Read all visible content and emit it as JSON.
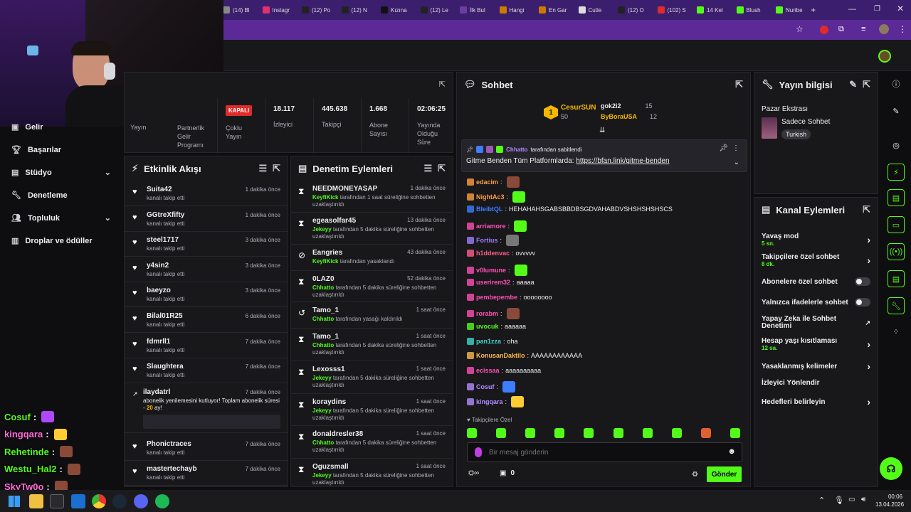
{
  "browser": {
    "tabs": [
      "(14) Bl",
      "Instagr",
      "(12) Po",
      "(12) N",
      "Kızına",
      "(12) Le",
      "İlk Bul",
      "Hangi",
      "En Gar",
      "Cutle",
      "(12) O",
      "(102) S",
      "14 Kel",
      "Blush",
      "Nuribe"
    ],
    "new_tab": "+"
  },
  "stats": {
    "status": "KAPALI",
    "items": [
      {
        "value": "",
        "label": "Yayın"
      },
      {
        "value": "",
        "label": "Partnerlik Gelir Programı"
      },
      {
        "value": "",
        "label": "Çoklu Yayın"
      },
      {
        "value": "18.117",
        "label": "İzleyici"
      },
      {
        "value": "445.638",
        "label": "Takipçi"
      },
      {
        "value": "1.668",
        "label": "Abone Sayısı"
      },
      {
        "value": "02:06:25",
        "label": "Yayında Olduğu Süre"
      }
    ]
  },
  "sidebar": {
    "items": [
      {
        "label": "Gelir"
      },
      {
        "label": "Başarılar"
      },
      {
        "label": "Stüdyo"
      },
      {
        "label": "Denetleme"
      },
      {
        "label": "Topluluk"
      },
      {
        "label": "Droplar ve ödüller"
      }
    ]
  },
  "activity": {
    "title": "Etkinlik Akışı",
    "events": [
      {
        "name": "Suita42",
        "time": "1 dakika önce",
        "desc": "kanalı takip etti"
      },
      {
        "name": "GGtreXfifty",
        "time": "1 dakika önce",
        "desc": "kanalı takip etti"
      },
      {
        "name": "steel1717",
        "time": "3 dakika önce",
        "desc": "kanalı takip etti"
      },
      {
        "name": "y4sin2",
        "time": "3 dakika önce",
        "desc": "kanalı takip etti"
      },
      {
        "name": "baeyzo",
        "time": "3 dakika önce",
        "desc": "kanalı takip etti"
      },
      {
        "name": "Bilal01R25",
        "time": "6 dakika önce",
        "desc": "kanalı takip etti"
      },
      {
        "name": "fdmrll1",
        "time": "7 dakika önce",
        "desc": "kanalı takip etti"
      },
      {
        "name": "Slaughtera",
        "time": "7 dakika önce",
        "desc": "kanalı takip etti"
      }
    ],
    "sub_event": {
      "name": "ilaydatrl",
      "time": "7 dakika önce",
      "desc": "abonelik yenilemesini kutluyor! Toplam abonelik süresi - ",
      "months": "20",
      "unit": "ay!"
    },
    "more_events": [
      {
        "name": "Phonictraces",
        "time": "7 dakika önce",
        "desc": "kanalı takip etti"
      },
      {
        "name": "mastertechayb",
        "time": "7 dakika önce",
        "desc": "kanalı takip etti"
      }
    ]
  },
  "mod": {
    "title": "Denetim Eylemleri",
    "actions": [
      {
        "name": "NEEDMONEYASAP",
        "time": "1 dakika önce",
        "by": "KeyfiKick",
        "text": " tarafından 1 saat süreliğine sohbetten uzaklaştırıldı"
      },
      {
        "name": "egeasolfar45",
        "time": "13 dakika önce",
        "by": "Jekeyy",
        "text": " tarafından 5 dakika süreliğine sohbetten uzaklaştırıldı"
      },
      {
        "name": "Eangries",
        "time": "43 dakika önce",
        "by": "KeyfiKick",
        "text": " tarafından yasaklandı"
      },
      {
        "name": "0LAZ0",
        "time": "52 dakika önce",
        "by": "Chhatto",
        "text": " tarafından 5 dakika süreliğine sohbetten uzaklaştırıldı"
      },
      {
        "name": "Tamo_1",
        "time": "1 saat önce",
        "by": "Chhatto",
        "text": " tarafından yasağı kaldırıldı"
      },
      {
        "name": "Tamo_1",
        "time": "1 saat önce",
        "by": "Chhatto",
        "text": " tarafından 5 dakika süreliğine sohbetten uzaklaştırıldı"
      },
      {
        "name": "Lexosss1",
        "time": "1 saat önce",
        "by": "Jekeyy",
        "text": " tarafından 5 dakika süreliğine sohbetten uzaklaştırıldı"
      },
      {
        "name": "koraydins",
        "time": "1 saat önce",
        "by": "Jekeyy",
        "text": " tarafından 5 dakika süreliğine sohbetten uzaklaştırıldı"
      },
      {
        "name": "donaldresler38",
        "time": "1 saat önce",
        "by": "Chhatto",
        "text": " tarafından 5 dakika süreliğine sohbetten uzaklaştırıldı"
      },
      {
        "name": "Oguzsmall",
        "time": "1 saat önce",
        "by": "Jekeyy",
        "text": " tarafından 5 dakika süreliğine sohbetten uzaklaştırıldı"
      }
    ]
  },
  "chat": {
    "title": "Sohbet",
    "leader": {
      "name": "CesurSUN",
      "count": "50"
    },
    "leaders": [
      {
        "name": "gok2i2",
        "count": "15"
      },
      {
        "name": "ByBoraUSA",
        "count": "12"
      }
    ],
    "pinned": {
      "by": "Chhatto",
      "label": "tarafından sabitlendi",
      "text": "Gitme Benden Tüm Platformlarda: ",
      "link": "https://bfan.link/gitme-benden"
    },
    "messages": [
      {
        "user": "edacim",
        "color": "#ff9d3d",
        "text": ""
      },
      {
        "user": "NightAc3",
        "color": "#ff9d3d",
        "text": ""
      },
      {
        "user": "BleibtQL",
        "color": "#3d7dff",
        "text": "HEHAHAHSGABSBBDBSGDVAHABDVSHSHSHSHSCS"
      },
      {
        "user": "arriamore",
        "color": "#ff4fb5",
        "text": ""
      },
      {
        "user": "Fortius",
        "color": "#9b7dff",
        "text": ""
      },
      {
        "user": "h1ddenvac",
        "color": "#ff5c8a",
        "text": "ovvvvv"
      },
      {
        "user": "v0lumune",
        "color": "#ff4fb5",
        "text": ""
      },
      {
        "user": "userirem32",
        "color": "#ff4fb5",
        "text": "aaaaa"
      },
      {
        "user": "pembepembe",
        "color": "#ff4fb5",
        "text": "oooooooo"
      },
      {
        "user": "rorabm",
        "color": "#ff4fb5",
        "text": ""
      },
      {
        "user": "uvocuk",
        "color": "#53fc18",
        "text": "aaaaaa"
      },
      {
        "user": "pan1zza",
        "color": "#3dd6d0",
        "text": "oha"
      },
      {
        "user": "KonusanDaktilo",
        "color": "#ffb84d",
        "text": "AAAAAAAAAAAA"
      },
      {
        "user": "ecissaa",
        "color": "#ff4fb5",
        "text": "aaaaaaaaaa"
      },
      {
        "user": "Cosuf",
        "color": "#b48bff",
        "text": ""
      },
      {
        "user": "kingqara",
        "color": "#b48bff",
        "text": ""
      }
    ],
    "followers_only": "Takipçilere Özel",
    "placeholder": "Bir mesaj gönderin",
    "points": "0",
    "send": "Gönder"
  },
  "info": {
    "title": "Yayın bilgisi",
    "stream_title": "Pazar Ekstrası",
    "category": "Sadece Sohbet",
    "tag": "Turkish"
  },
  "channel": {
    "title": "Kanal Eylemleri",
    "items": [
      {
        "label": "Yavaş mod",
        "sub": "5 sn."
      },
      {
        "label": "Takipçilere özel sohbet",
        "sub": "8 dk."
      },
      {
        "label": "Abonelere özel sohbet",
        "sub": ""
      },
      {
        "label": "Yalnızca ifadelerle sohbet",
        "sub": ""
      },
      {
        "label": "Yapay Zeka ile Sohbet Denetimi",
        "sub": ""
      },
      {
        "label": "Hesap yaşı kısıtlaması",
        "sub": "12 sa."
      },
      {
        "label": "Yasaklanmış kelimeler",
        "sub": ""
      },
      {
        "label": "İzleyici Yönlendir",
        "sub": ""
      },
      {
        "label": "Hedefleri belirleyin",
        "sub": ""
      }
    ]
  },
  "overlay": {
    "chat": [
      {
        "user": "Cosuf",
        "color": "#53fc18"
      },
      {
        "user": "kingqara",
        "color": "#ff6bd6"
      },
      {
        "user": "Rehetinde",
        "color": "#53fc18"
      },
      {
        "user": "Westu_Hal2",
        "color": "#53fc18"
      },
      {
        "user": "SkyTw0o",
        "color": "#ff6bd6"
      }
    ]
  },
  "taskbar": {
    "time": "00:06",
    "date": "13.04.2026"
  }
}
